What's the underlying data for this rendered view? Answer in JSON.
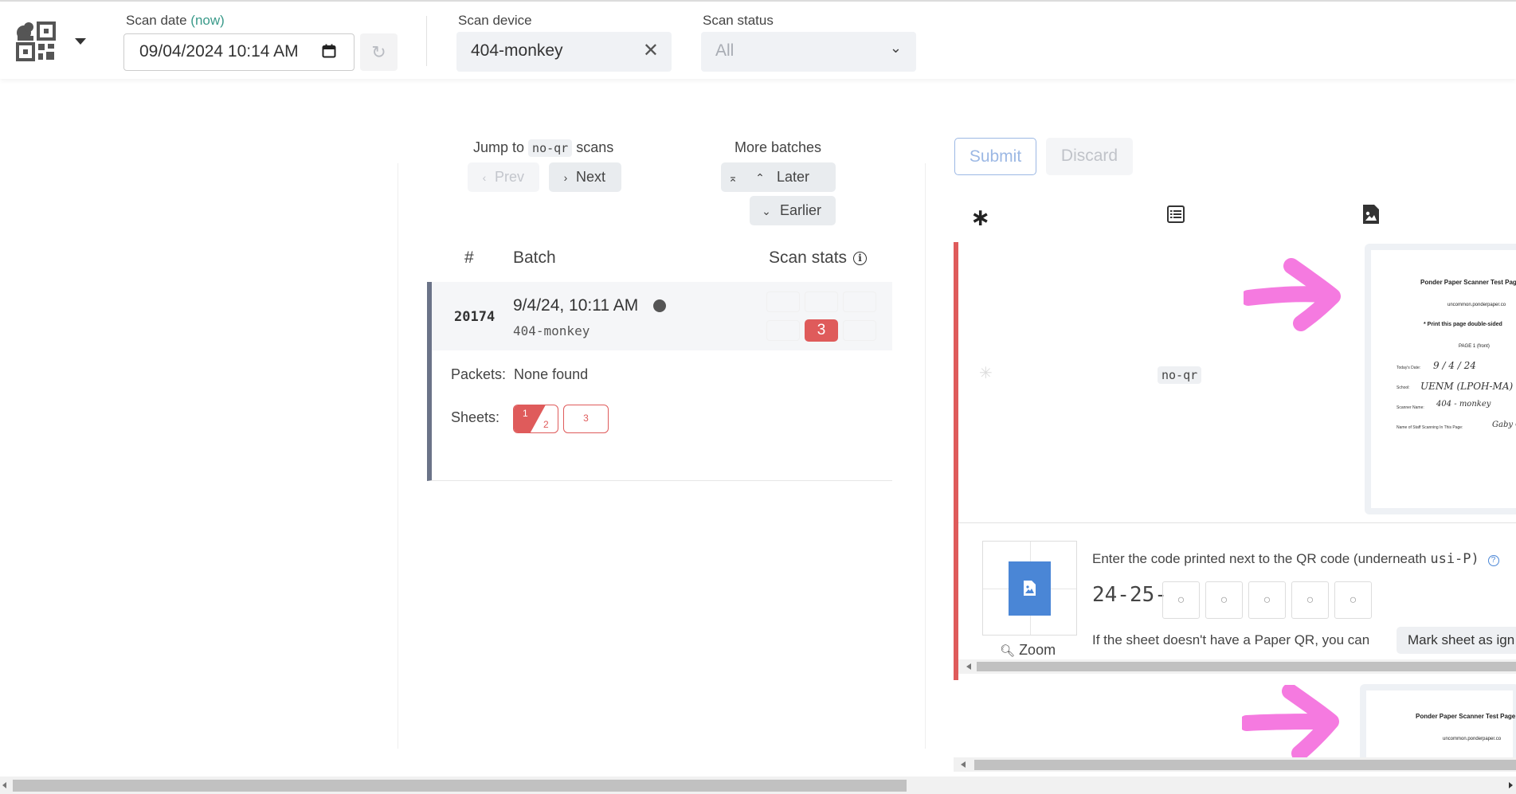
{
  "navbar": {
    "scan_date": {
      "label": "Scan date",
      "now_label": "(now)",
      "value": "09/04/2024  10:14  AM"
    },
    "scan_device": {
      "label": "Scan device",
      "value": "404-monkey"
    },
    "scan_status": {
      "label": "Scan status",
      "placeholder": "All"
    }
  },
  "center": {
    "jump": {
      "prefix": "Jump to",
      "code": "no-qr",
      "suffix": "scans",
      "prev_label": "Prev",
      "next_label": "Next"
    },
    "batches": {
      "title": "More batches",
      "later_label": "Later",
      "earlier_label": "Earlier"
    },
    "table": {
      "headers": {
        "num": "#",
        "batch": "Batch",
        "stats": "Scan stats"
      },
      "row": {
        "id": "20174",
        "date": "9/4/24, 10:11 AM",
        "device": "404-monkey",
        "error_count": "3"
      }
    },
    "packets": {
      "label": "Packets:",
      "value": "None found"
    },
    "sheets": {
      "label": "Sheets:",
      "items": [
        "1",
        "2",
        "3"
      ]
    }
  },
  "review": {
    "submit_label": "Submit",
    "discard_label": "Discard",
    "tabs": [
      "asterisk-icon",
      "list-icon",
      "image-icon"
    ],
    "tag": "no-qr",
    "preview": {
      "title": "Ponder Paper Scanner Test Page",
      "site": "uncommon.ponderpaper.co",
      "note": "* Print this page double-sided",
      "page": "PAGE 1 (front)",
      "fields": [
        {
          "label": "Today's Date:",
          "value": "9 / 4 / 24"
        },
        {
          "label": "School:",
          "value": "UENM (LPOH-MA)"
        },
        {
          "label": "Scanner Name:",
          "value": "404 - monkey"
        },
        {
          "label": "Name of Staff Scanning In This Page:",
          "value": "Gaby C"
        }
      ]
    },
    "enter_code_text": "Enter the code printed next to the QR code (underneath",
    "enter_code_mono": "usi-P)",
    "code_prefix": "24-25-",
    "code_placeholder": "○",
    "ignore_text": "If the sheet doesn't have a Paper QR, you can",
    "mark_label": "Mark sheet as ign",
    "zoom_label": "Zoom",
    "preview2": {
      "title": "Ponder Paper Scanner Test Page",
      "site": "uncommon.ponderpaper.co"
    }
  },
  "colors": {
    "error": "#df5b5b",
    "accent_blue": "#4a86d6",
    "arrow_pink": "#f57ae0",
    "teal": "#3a9a8a"
  }
}
